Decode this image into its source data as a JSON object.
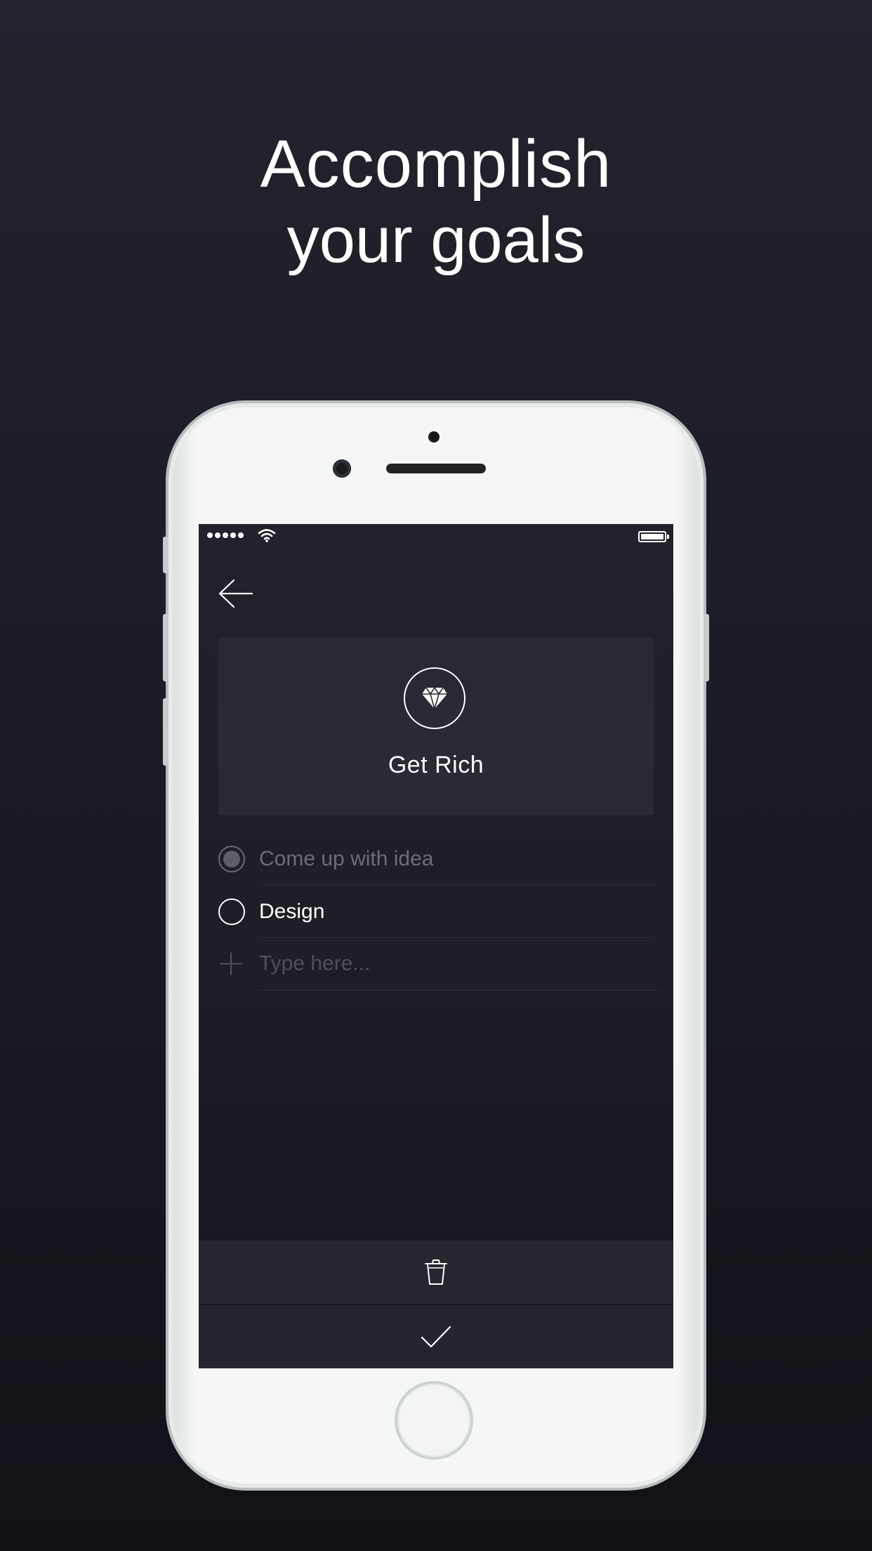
{
  "headline": {
    "line1": "Accomplish",
    "line2": "your goals"
  },
  "status_bar": {
    "signal_icon": "signal-dots-icon",
    "wifi_icon": "wifi-icon",
    "battery_icon": "battery-full-icon"
  },
  "nav": {
    "back_icon": "arrow-left-icon"
  },
  "goal": {
    "icon": "diamond-icon",
    "title": "Get Rich"
  },
  "tasks": [
    {
      "label": "Come up with idea",
      "completed": true
    },
    {
      "label": "Design",
      "completed": false
    }
  ],
  "new_task": {
    "icon": "plus-icon",
    "placeholder": "Type here..."
  },
  "actions": {
    "delete_icon": "trash-icon",
    "confirm_icon": "checkmark-icon"
  },
  "colors": {
    "background": "#1f1f29",
    "screen_background": "#1d1d26",
    "card_background": "#292933",
    "text_primary": "#ffffff",
    "text_muted": "#6d6d78",
    "placeholder": "#4f4f5a"
  }
}
